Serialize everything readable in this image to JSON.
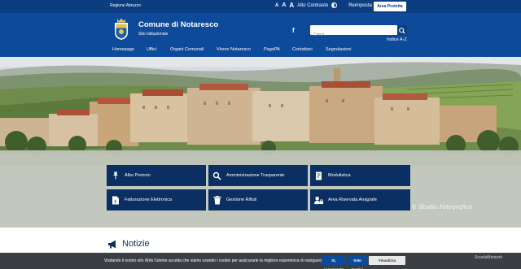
{
  "topbar": {
    "region": "Regione Abruzzo",
    "font_small": "A",
    "font_medium": "A",
    "font_large": "A",
    "contrast": "Alto Contrasto",
    "reset": "Reimposta",
    "area_button": "Area Protetta"
  },
  "header": {
    "title": "Comune di Notaresco",
    "subtitle": "Sito Istituzionale",
    "facebook": "f",
    "search_placeholder": "Cerca",
    "index_link": "Indice A-Z"
  },
  "nav": {
    "items": [
      "Homepage",
      "Uffici",
      "Organi Comunali",
      "Vivere Notaresco",
      "PagoPA",
      "Contattaci",
      "Segnalazioni"
    ]
  },
  "hero": {
    "watermark": "© Studio Fotografico"
  },
  "tiles": [
    {
      "label": "Albo Pretorio",
      "icon": "pin-icon"
    },
    {
      "label": "Amministrazione Trasparente",
      "icon": "search-icon"
    },
    {
      "label": "Modulistica",
      "icon": "document-edit-icon"
    },
    {
      "label": "Fatturazione Elettronica",
      "icon": "invoice-icon"
    },
    {
      "label": "Gestione Rifiuti",
      "icon": "trash-icon"
    },
    {
      "label": "Area Riservata Anagrafe",
      "icon": "user-lock-icon"
    }
  ],
  "news": {
    "title": "Notizie"
  },
  "cookie": {
    "message": "Visitando il nostro sito Web l'utente accetta che siamo usando i cookie per assicurarle la migliore esperienza di navigazione.",
    "accept": "Sì, acconsento",
    "tech_only": "Solo tecnici",
    "info": "Visualizza informative",
    "brand": "ScuolaMetwork"
  },
  "colors": {
    "primary": "#0d4a9a",
    "topbar": "#0b3d80",
    "tile": "#0b2f62",
    "cookie_bg": "#3b3f44"
  }
}
